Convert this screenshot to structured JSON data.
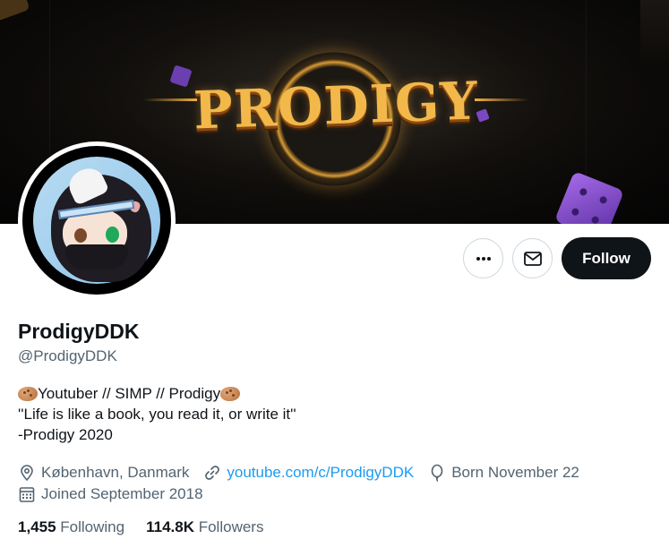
{
  "banner": {
    "logo_text": "PRODIGY"
  },
  "profile": {
    "display_name": "ProdigyDDK",
    "handle": "@ProdigyDDK",
    "bio_line_1_text": "Youtuber // SIMP // Prodigy",
    "bio_line_2": "''Life is like a book, you read it, or write it''",
    "bio_line_3": "-Prodigy 2020",
    "location": "København, Danmark",
    "website": "youtube.com/c/ProdigyDDK",
    "birthday": "Born November 22",
    "joined": "Joined September 2018",
    "following_count": "1,455",
    "following_label": "Following",
    "followers_count": "114.8K",
    "followers_label": "Followers"
  },
  "actions": {
    "more_icon": "more-horizontal-icon",
    "message_icon": "envelope-icon",
    "follow_label": "Follow"
  },
  "colors": {
    "follow_bg": "#0f1419",
    "link": "#1d9bf0",
    "secondary_text": "#536471"
  }
}
